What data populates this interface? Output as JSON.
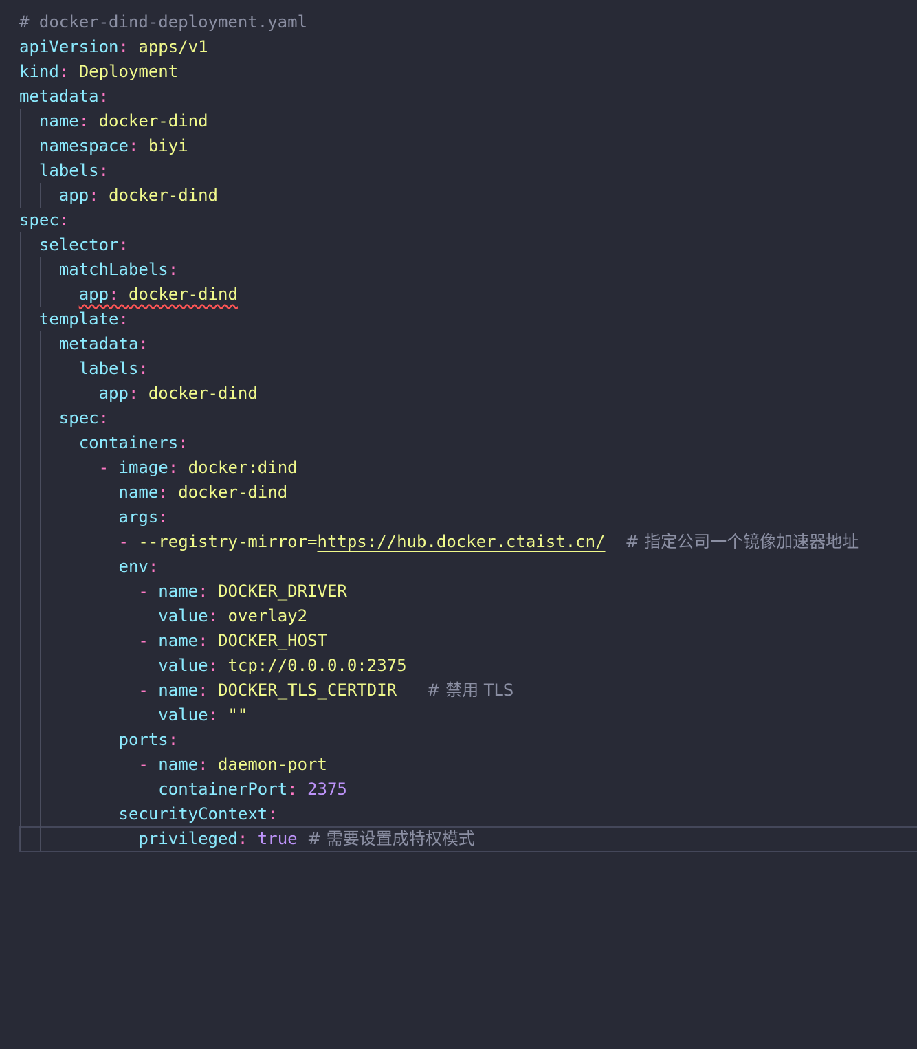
{
  "file": {
    "header_comment": "# docker-dind-deployment.yaml"
  },
  "yaml": {
    "apiVersion": {
      "key": "apiVersion",
      "value": "apps/v1"
    },
    "kind": {
      "key": "kind",
      "value": "Deployment"
    },
    "metadata": {
      "key": "metadata",
      "name": {
        "key": "name",
        "value": "docker-dind"
      },
      "namespace": {
        "key": "namespace",
        "value": "biyi"
      },
      "labels": {
        "key": "labels",
        "app": {
          "key": "app",
          "value": "docker-dind"
        }
      }
    },
    "spec": {
      "key": "spec",
      "selector": {
        "key": "selector",
        "matchLabels": {
          "key": "matchLabels",
          "app": {
            "key": "app",
            "value": "docker-dind"
          }
        }
      },
      "template": {
        "key": "template",
        "metadata": {
          "key": "metadata",
          "labels": {
            "key": "labels",
            "app": {
              "key": "app",
              "value": "docker-dind"
            }
          }
        },
        "spec": {
          "key": "spec",
          "containers": {
            "key": "containers",
            "image": {
              "key": "image",
              "value": "docker:dind"
            },
            "name": {
              "key": "name",
              "value": "docker-dind"
            },
            "args": {
              "key": "args",
              "item_prefix": "--registry-mirror=",
              "item_url": "https://hub.docker.ctaist.cn/",
              "comment": "# 指定公司一个镜像加速器地址"
            },
            "env": {
              "key": "env",
              "items": [
                {
                  "name_key": "name",
                  "name": "DOCKER_DRIVER",
                  "value_key": "value",
                  "value": "overlay2",
                  "comment": ""
                },
                {
                  "name_key": "name",
                  "name": "DOCKER_HOST",
                  "value_key": "value",
                  "value": "tcp://0.0.0.0:2375",
                  "comment": ""
                },
                {
                  "name_key": "name",
                  "name": "DOCKER_TLS_CERTDIR",
                  "value_key": "value",
                  "value": "\"\"",
                  "comment": "# 禁用 TLS"
                }
              ]
            },
            "ports": {
              "key": "ports",
              "name": {
                "key": "name",
                "value": "daemon-port"
              },
              "containerPort": {
                "key": "containerPort",
                "value": "2375"
              }
            },
            "securityContext": {
              "key": "securityContext",
              "privileged": {
                "key": "privileged",
                "value": "true",
                "comment": "# 需要设置成特权模式"
              }
            }
          }
        }
      }
    }
  },
  "colors": {
    "background": "#282a36",
    "key": "#8be9fd",
    "string": "#f1fa8c",
    "punctuation": "#ff79c6",
    "number": "#bd93f9",
    "comment": "#8b8fa3",
    "error_squiggle": "#ff5555"
  }
}
